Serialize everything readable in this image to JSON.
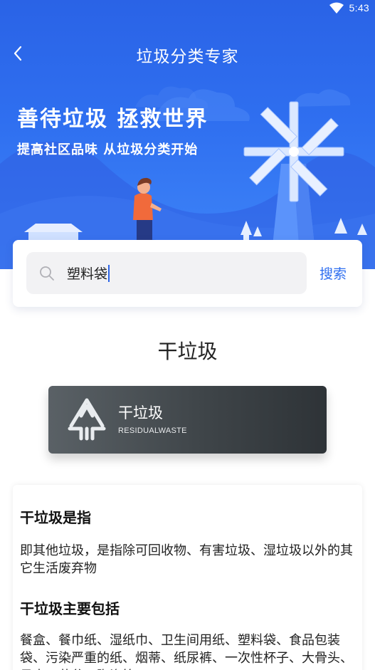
{
  "status_bar": {
    "time": "5:43",
    "wifi_icon": "wifi-icon"
  },
  "app_bar": {
    "title": "垃圾分类专家",
    "back_icon": "chevron-left-icon"
  },
  "banner": {
    "slogan_main": "善待垃圾 拯救世界",
    "slogan_sub": "提高社区品味 从垃圾分类开始",
    "colors": {
      "top": "#2a63e6",
      "bottom": "#3f86f8"
    }
  },
  "search": {
    "value": "塑料袋",
    "button_label": "搜索",
    "icon": "search-icon"
  },
  "result": {
    "category_title": "干垃圾",
    "badge_name": "干垃圾",
    "badge_en": "RESIDUALWASTE"
  },
  "info": {
    "definition_heading": "干垃圾是指",
    "definition_text": "即其他垃圾，是指除可回收物、有害垃圾、湿垃圾以外的其它生活废弃物",
    "includes_heading": "干垃圾主要包括",
    "includes_text": "餐盒、餐巾纸、湿纸巾、卫生间用纸、塑料袋、食品包装袋、污染严重的纸、烟蒂、纸尿裤、一次性杯子、大骨头、贝壳、花盆、陶瓷等"
  }
}
